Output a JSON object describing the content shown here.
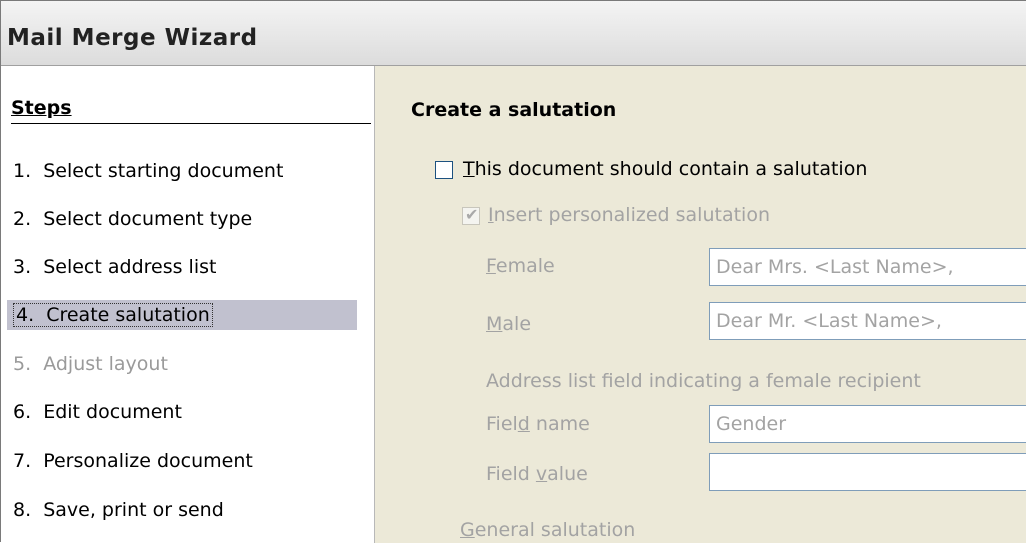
{
  "window": {
    "title": "Mail Merge Wizard"
  },
  "steps": {
    "heading": "Steps",
    "items": [
      {
        "label": "1.  Select starting document",
        "state": "normal"
      },
      {
        "label": "2.  Select document type",
        "state": "normal"
      },
      {
        "label": "3.  Select address list",
        "state": "normal"
      },
      {
        "label": "4.  Create salutation",
        "state": "active"
      },
      {
        "label": "5.  Adjust layout",
        "state": "disabled"
      },
      {
        "label": "6.  Edit document",
        "state": "normal"
      },
      {
        "label": "7.  Personalize document",
        "state": "normal"
      },
      {
        "label": "8.  Save, print or send",
        "state": "normal"
      }
    ]
  },
  "main": {
    "section_title": "Create a salutation",
    "contain_salutation": {
      "label_first": "T",
      "label_rest": "his document should contain a salutation",
      "checked": false
    },
    "insert_personalized": {
      "label_first": "I",
      "label_rest": "nsert personalized salutation",
      "checked": true
    },
    "female": {
      "label_first": "F",
      "label_rest": "emale",
      "value": "Dear Mrs. <Last Name>,"
    },
    "male": {
      "label_first": "M",
      "label_rest": "ale",
      "value": "Dear Mr. <Last Name>,"
    },
    "address_field_heading": "Address list field indicating a female recipient",
    "field_name": {
      "label_before": "Fiel",
      "label_mnemonic": "d",
      "label_after": " name",
      "value": "Gender"
    },
    "field_value": {
      "label_before": "Field ",
      "label_mnemonic": "v",
      "label_after": "alue",
      "value": ""
    },
    "general_salutation": {
      "label_first": "G",
      "label_rest": "eneral salutation"
    }
  },
  "colors": {
    "active_step_bg": "#c1c1cf",
    "dialog_bg": "#ece9d8",
    "disabled_text": "#a3a3a3"
  }
}
